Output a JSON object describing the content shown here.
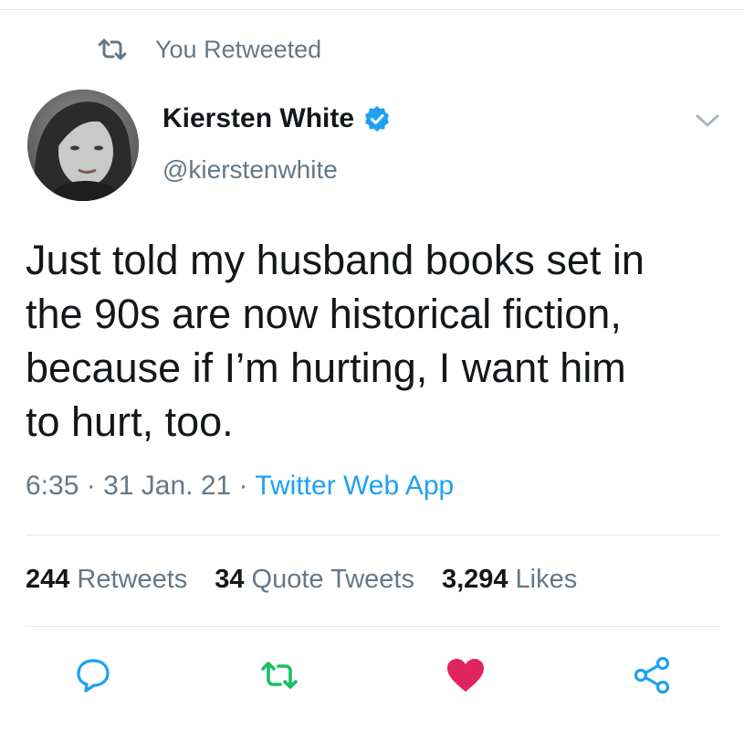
{
  "context": {
    "retweet_label": "You Retweeted",
    "icon": "retweet-icon"
  },
  "author": {
    "name": "Kiersten White",
    "handle": "@kierstenwhite",
    "verified": true,
    "avatar_icon": "profile-photo"
  },
  "tweet": {
    "text": "Just told my husband books set in\nthe 90s are now historical fiction,\nbecause if I’m hurting, I want him\nto hurt, too.",
    "time": "6:35",
    "date": "31 Jan. 21",
    "separator": "·",
    "source": "Twitter Web App"
  },
  "stats": {
    "retweets_count": "244",
    "retweets_label": "Retweets",
    "quotes_count": "34",
    "quotes_label": "Quote Tweets",
    "likes_count": "3,294",
    "likes_label": "Likes"
  },
  "actions": {
    "reply_icon": "reply-icon",
    "retweet_icon": "retweet-icon",
    "like_icon": "heart-icon",
    "share_icon": "share-icon"
  },
  "colors": {
    "accent": "#1da1f2",
    "retweet_green": "#17bf63",
    "like_red": "#e0245e",
    "secondary_text": "#657786"
  }
}
